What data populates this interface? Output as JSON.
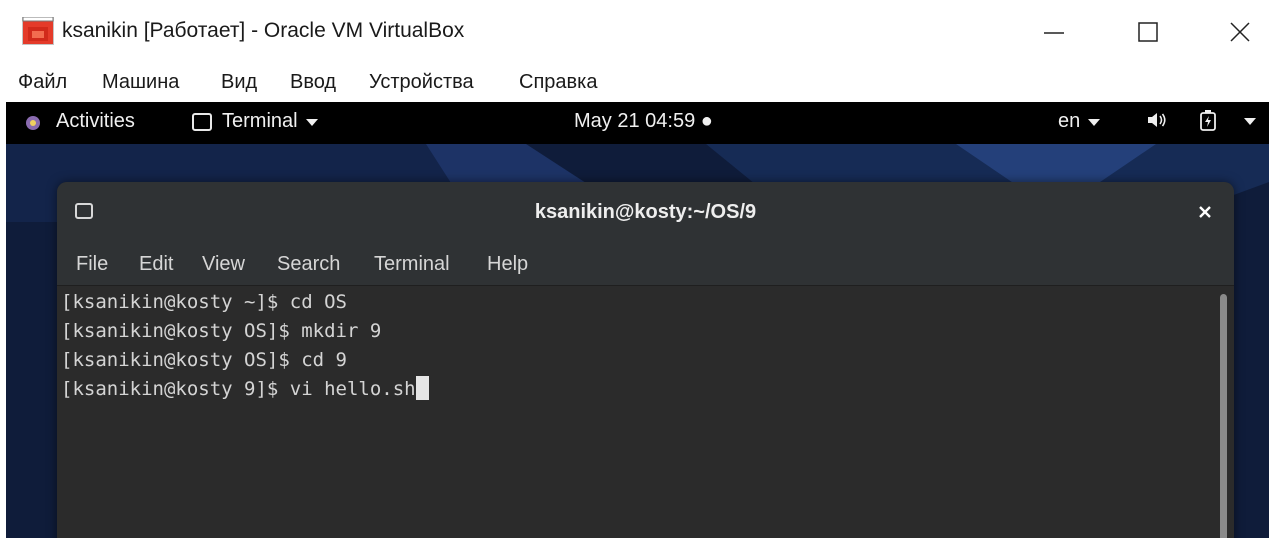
{
  "host_window": {
    "title": "ksanikin [Работает] - Oracle VM VirtualBox",
    "menu": [
      "Файл",
      "Машина",
      "Вид",
      "Ввод",
      "Устройства",
      "Справка"
    ]
  },
  "guest_topbar": {
    "activities": "Activities",
    "app_menu": "Terminal",
    "clock": "May 21  04:59 ●",
    "lang": "en"
  },
  "terminal": {
    "title": "ksanikin@kosty:~/OS/9",
    "menu": [
      "File",
      "Edit",
      "View",
      "Search",
      "Terminal",
      "Help"
    ],
    "lines": [
      "[ksanikin@kosty ~]$ cd OS",
      "[ksanikin@kosty OS]$ mkdir 9",
      "[ksanikin@kosty OS]$ cd 9",
      "[ksanikin@kosty 9]$ vi hello.sh"
    ]
  },
  "colors": {
    "topbar": "#000000",
    "terminal_bg": "#2b2b2b",
    "headerbar": "#2f3234",
    "wallpaper": "#0f1c3a"
  }
}
